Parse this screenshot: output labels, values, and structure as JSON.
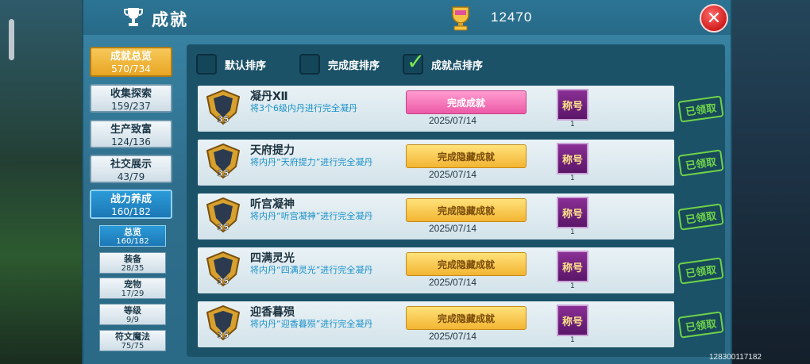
{
  "header": {
    "title": "成就",
    "points": "12470",
    "close_label": "✕"
  },
  "sidebar": {
    "categories": [
      {
        "label": "成就总览",
        "count": "570/734"
      },
      {
        "label": "收集探索",
        "count": "159/237"
      },
      {
        "label": "生产致富",
        "count": "124/136"
      },
      {
        "label": "社交展示",
        "count": "43/79"
      },
      {
        "label": "战力养成",
        "count": "160/182"
      }
    ],
    "subcategories": [
      {
        "label": "总览",
        "count": "160/182"
      },
      {
        "label": "装备",
        "count": "28/35"
      },
      {
        "label": "宠物",
        "count": "17/29"
      },
      {
        "label": "等级",
        "count": "9/9"
      },
      {
        "label": "符文魔法",
        "count": "75/75"
      }
    ]
  },
  "sort": {
    "default": "默认排序",
    "completion": "完成度排序",
    "points": "成就点排序"
  },
  "rows": [
    {
      "level": "35",
      "name": "凝丹Ⅻ",
      "desc": "将3个6级内丹进行完全凝丹",
      "status": "完成成就",
      "date": "2025/07/14",
      "title_label": "称号",
      "count": "1",
      "claimed": "已领取"
    },
    {
      "level": "35",
      "name": "天府提力",
      "desc": "将内丹“天府提力”进行完全凝丹",
      "status": "完成隐藏成就",
      "date": "2025/07/14",
      "title_label": "称号",
      "count": "1",
      "claimed": "已领取"
    },
    {
      "level": "35",
      "name": "听宫凝神",
      "desc": "将内丹“听宫凝神”进行完全凝丹",
      "status": "完成隐藏成就",
      "date": "2025/07/14",
      "title_label": "称号",
      "count": "1",
      "claimed": "已领取"
    },
    {
      "level": "35",
      "name": "四满灵光",
      "desc": "将内丹“四满灵光”进行完全凝丹",
      "status": "完成隐藏成就",
      "date": "2025/07/14",
      "title_label": "称号",
      "count": "1",
      "claimed": "已领取"
    },
    {
      "level": "35",
      "name": "迎香暮殒",
      "desc": "将内丹“迎香暮殒”进行完全凝丹",
      "status": "完成隐藏成就",
      "date": "2025/07/14",
      "title_label": "称号",
      "count": "1",
      "claimed": "已领取"
    }
  ],
  "uid": "128300117182",
  "colors": {
    "accent": "#2b9bd8",
    "gold": "#f3b533",
    "pink": "#ec5aa6",
    "claimed": "#6fd24a"
  }
}
